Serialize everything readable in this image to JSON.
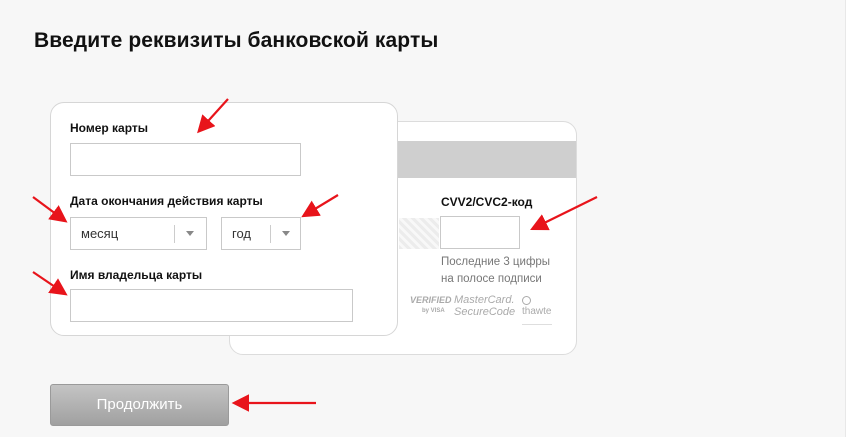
{
  "page": {
    "title": "Введите реквизиты банковской карты"
  },
  "front_card": {
    "card_number": {
      "label": "Номер карты",
      "value": "",
      "placeholder": ""
    },
    "expiry": {
      "label": "Дата окончания действия карты",
      "month": {
        "value": "месяц"
      },
      "year": {
        "value": "год"
      }
    },
    "holder": {
      "label": "Имя владельца карты",
      "value": "",
      "placeholder": ""
    }
  },
  "back_card": {
    "cvv": {
      "label": "CVV2/CVC2-код",
      "value": "",
      "placeholder": ""
    },
    "hint_line1": "Последние 3 цифры",
    "hint_line2": "на полосе подписи",
    "logos": {
      "verified": "VERIFIED",
      "verified_sub": "by VISA",
      "mastercard_line1": "MasterCard.",
      "mastercard_line2": "SecureCode",
      "thawte": "thawte"
    }
  },
  "actions": {
    "continue_label": "Продолжить"
  },
  "colors": {
    "arrow": "#e8141b",
    "button_top": "#c4c4c4",
    "button_bottom": "#a0a0a0",
    "page_bg": "#f7f7f7"
  }
}
